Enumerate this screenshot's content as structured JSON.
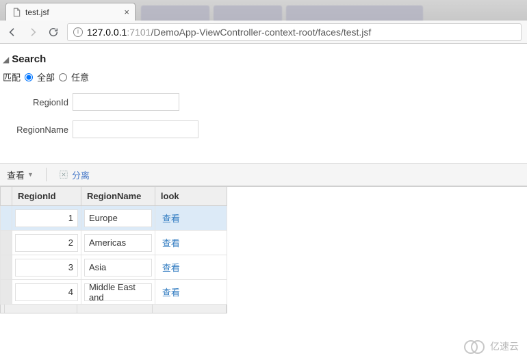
{
  "browser": {
    "tab_title": "test.jsf",
    "url_host": "127.0.0.1",
    "url_port": ":7101",
    "url_path": "/DemoApp-ViewController-context-root/faces/test.jsf"
  },
  "search": {
    "title": "Search",
    "match_label": "匹配",
    "match_all": "全部",
    "match_any": "任意",
    "field_region_id": "RegionId",
    "field_region_name": "RegionName"
  },
  "table_toolbar": {
    "view_label": "查看",
    "detach_label": "分离"
  },
  "table": {
    "columns": {
      "region_id": "RegionId",
      "region_name": "RegionName",
      "look": "look"
    },
    "look_link_text": "查看",
    "rows": [
      {
        "id": "1",
        "name": "Europe",
        "selected": true
      },
      {
        "id": "2",
        "name": "Americas",
        "selected": false
      },
      {
        "id": "3",
        "name": "Asia",
        "selected": false
      },
      {
        "id": "4",
        "name": "Middle East and",
        "selected": false
      }
    ]
  },
  "watermark": "亿速云"
}
